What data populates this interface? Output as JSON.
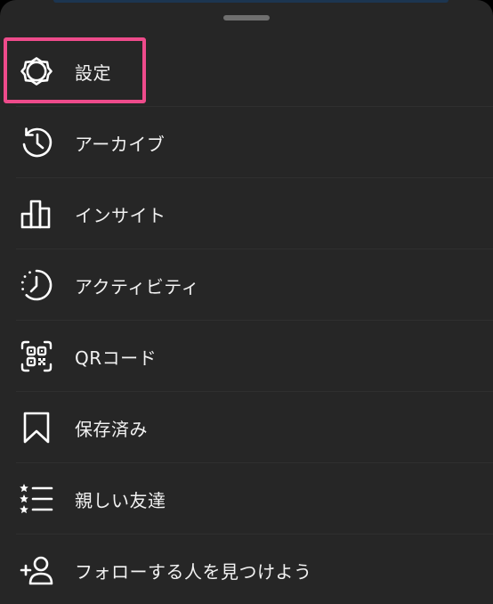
{
  "colors": {
    "sheet_background": "#262626",
    "text": "#f2f2f2",
    "icon_stroke": "#ffffff",
    "highlight_border": "#ee4b8b",
    "grabber": "#6f6f6f"
  },
  "menu": {
    "items": [
      {
        "label": "設定",
        "icon": "gear-icon"
      },
      {
        "label": "アーカイブ",
        "icon": "archive-history-icon"
      },
      {
        "label": "インサイト",
        "icon": "bar-chart-icon"
      },
      {
        "label": "アクティビティ",
        "icon": "activity-clock-icon"
      },
      {
        "label": "QRコード",
        "icon": "qr-code-icon"
      },
      {
        "label": "保存済み",
        "icon": "bookmark-icon"
      },
      {
        "label": "親しい友達",
        "icon": "close-friends-list-icon"
      },
      {
        "label": "フォローする人を見つけよう",
        "icon": "add-person-icon"
      }
    ]
  }
}
